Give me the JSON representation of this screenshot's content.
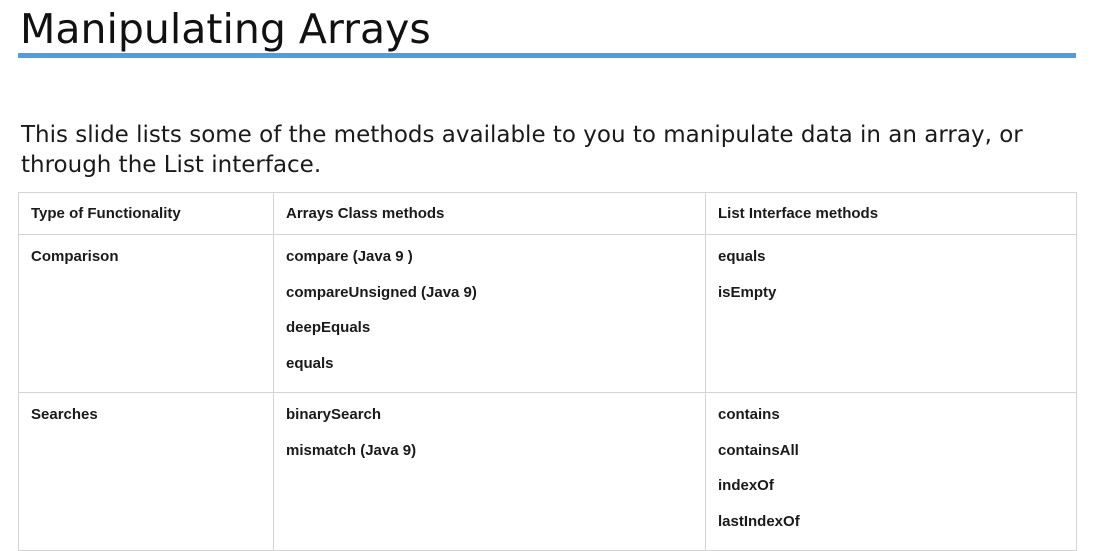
{
  "slide": {
    "title": "Manipulating Arrays",
    "intro": "This slide lists some of the methods available to you to manipulate data in an array, or through the List interface.",
    "accent_color": "#4a9ee8"
  },
  "table": {
    "headers": [
      "Type of Functionality",
      "Arrays Class methods",
      "List Interface methods"
    ],
    "rows": [
      {
        "type": "Comparison",
        "arrays_methods": [
          "compare  (Java 9 )",
          "compareUnsigned  (Java 9)",
          "deepEquals",
          "equals"
        ],
        "list_methods": [
          "equals",
          "isEmpty"
        ]
      },
      {
        "type": "Searches",
        "arrays_methods": [
          "binarySearch",
          "mismatch (Java 9)"
        ],
        "list_methods": [
          "contains",
          "containsAll",
          "indexOf",
          "lastIndexOf"
        ]
      }
    ]
  }
}
